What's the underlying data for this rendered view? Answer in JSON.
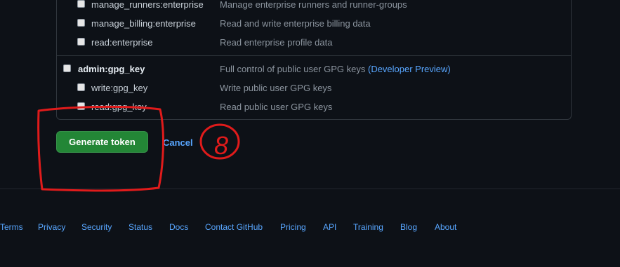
{
  "scopes": [
    {
      "name": "manage_runners:enterprise",
      "desc": "Manage enterprise runners and runner-groups",
      "parent": false
    },
    {
      "name": "manage_billing:enterprise",
      "desc": "Read and write enterprise billing data",
      "parent": false
    },
    {
      "name": "read:enterprise",
      "desc": "Read enterprise profile data",
      "parent": false
    },
    {
      "name": "admin:gpg_key",
      "desc": "Full control of public user GPG keys",
      "desc_link": "(Developer Preview)",
      "parent": true
    },
    {
      "name": "write:gpg_key",
      "desc": "Write public user GPG keys",
      "parent": false
    },
    {
      "name": "read:gpg_key",
      "desc": "Read public user GPG keys",
      "parent": false
    }
  ],
  "actions": {
    "generate_label": "Generate token",
    "cancel_label": "Cancel"
  },
  "annotation": {
    "number": "8",
    "color": "#e01b1b"
  },
  "footer": {
    "links": [
      "Terms",
      "Privacy",
      "Security",
      "Status",
      "Docs",
      "Contact GitHub",
      "Pricing",
      "API",
      "Training",
      "Blog",
      "About"
    ]
  },
  "colors": {
    "background": "#0d1117",
    "primary_button": "#238636",
    "link": "#58a6ff"
  }
}
